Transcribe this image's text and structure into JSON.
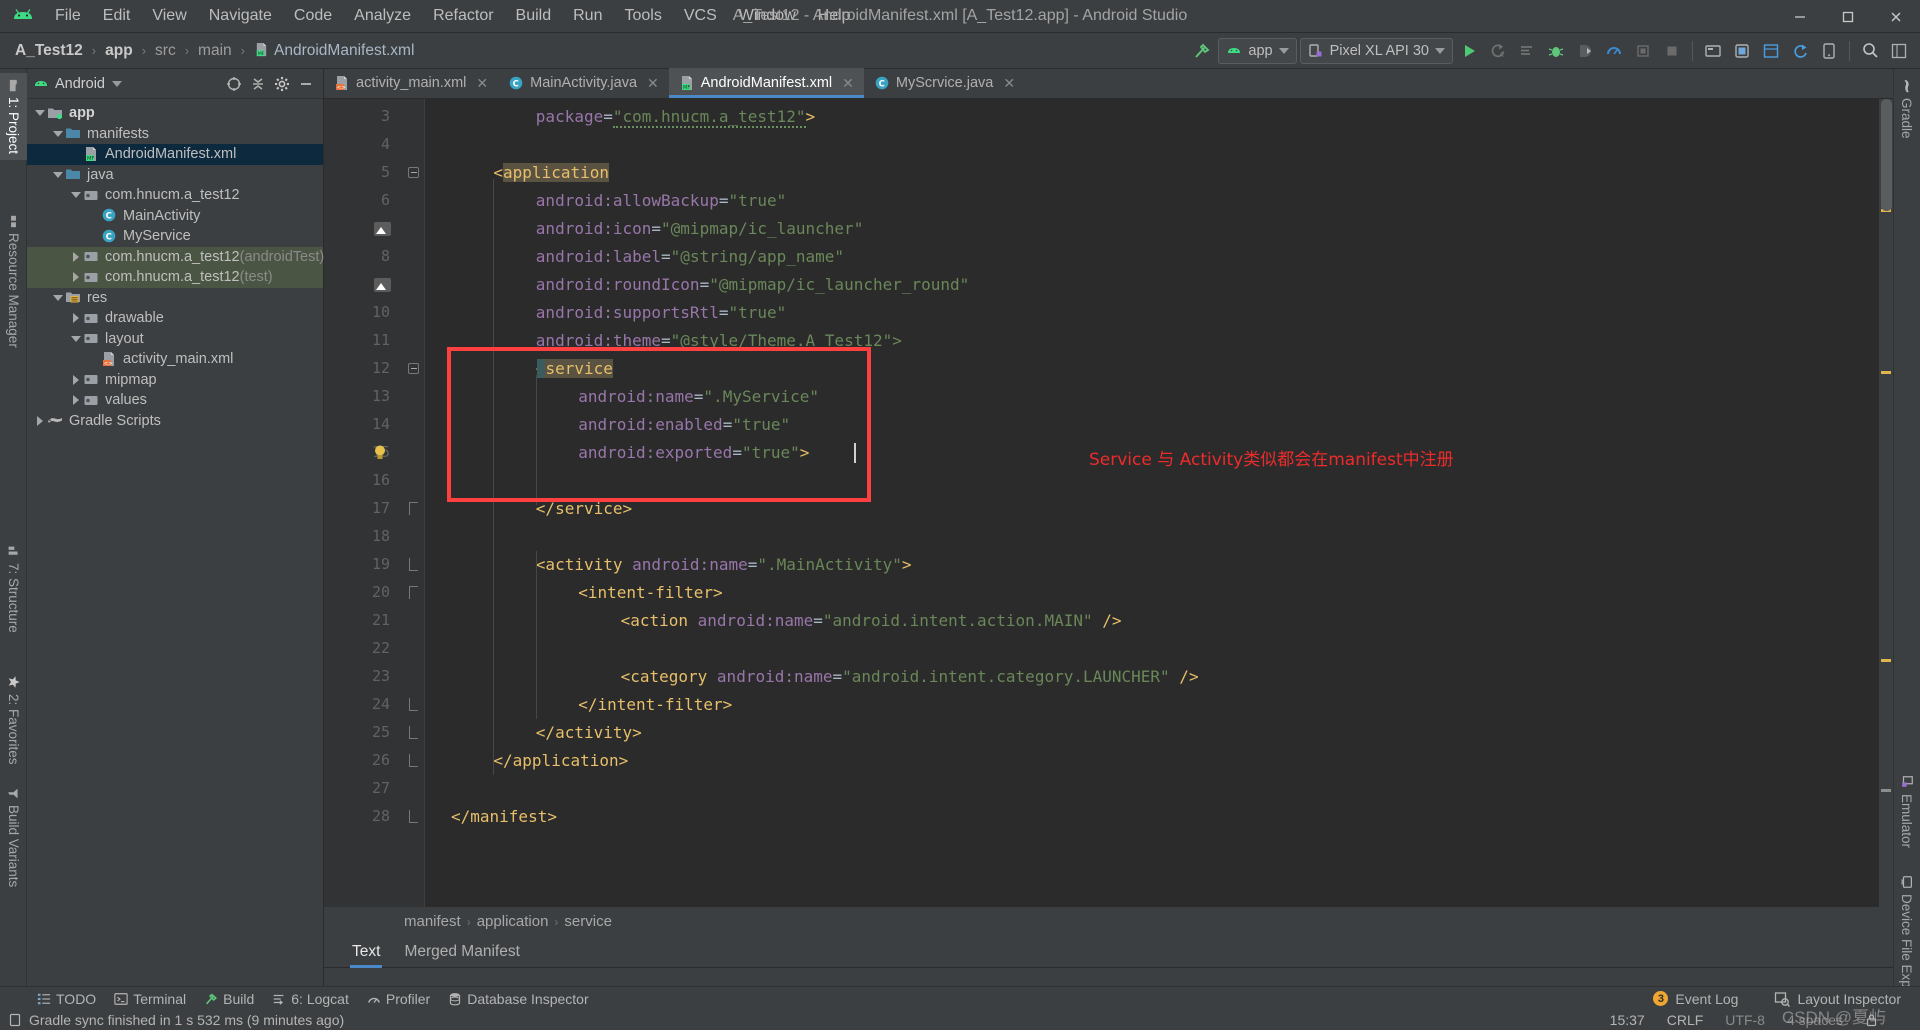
{
  "window": {
    "title": "A_Test12 - AndroidManifest.xml [A_Test12.app] - Android Studio",
    "minimize": "—",
    "maximize": "❐",
    "close": "✕"
  },
  "menubar": {
    "logo_icon": "android-logo-icon",
    "items": [
      {
        "label": "File",
        "mnemonic": "F"
      },
      {
        "label": "Edit",
        "mnemonic": "E"
      },
      {
        "label": "View",
        "mnemonic": "V"
      },
      {
        "label": "Navigate",
        "mnemonic": "N"
      },
      {
        "label": "Code",
        "mnemonic": "C"
      },
      {
        "label": "Analyze",
        "mnemonic": "z"
      },
      {
        "label": "Refactor",
        "mnemonic": "R"
      },
      {
        "label": "Build",
        "mnemonic": "B"
      },
      {
        "label": "Run",
        "mnemonic": "u"
      },
      {
        "label": "Tools",
        "mnemonic": "T"
      },
      {
        "label": "VCS",
        "mnemonic": "S"
      },
      {
        "label": "Window",
        "mnemonic": "W"
      },
      {
        "label": "Help",
        "mnemonic": "H"
      }
    ]
  },
  "navbar": {
    "breadcrumbs": [
      {
        "label": "A_Test12",
        "style": "bold"
      },
      {
        "label": "app",
        "style": "bold"
      },
      {
        "label": "src",
        "style": "dim"
      },
      {
        "label": "main",
        "style": "dim"
      },
      {
        "label": "AndroidManifest.xml",
        "style": "file",
        "icon": "manifest-file-icon"
      }
    ],
    "separator": "›",
    "build_icon": "build-hammer-icon",
    "module_selector": {
      "label": "app",
      "icon": "android-head-icon"
    },
    "device_selector": {
      "label": "Pixel XL API 30",
      "icon": "device-phone-icon"
    },
    "actions": [
      {
        "name": "run-button",
        "icon": "play-icon"
      },
      {
        "name": "apply-changes-button",
        "icon": "apply-changes-icon"
      },
      {
        "name": "apply-code-changes-button",
        "icon": "apply-code-changes-icon"
      },
      {
        "name": "debug-button",
        "icon": "bug-icon"
      },
      {
        "name": "attach-debugger-button",
        "icon": "attach-debugger-icon"
      },
      {
        "name": "profile-button",
        "icon": "profiler-icon"
      },
      {
        "name": "profile-cpu-button",
        "icon": "profile-cpu-icon"
      },
      {
        "name": "stop-button",
        "icon": "stop-icon"
      },
      {
        "name": "sdk-manager-button",
        "icon": "sdk-manager-icon"
      },
      {
        "name": "avd-manager-button",
        "icon": "avd-manager-icon"
      },
      {
        "name": "layout-inspector-button",
        "icon": "layout-inspector-icon"
      },
      {
        "name": "sync-gradle-button",
        "icon": "gradle-sync-icon"
      },
      {
        "name": "device-manager-button",
        "icon": "device-manager-icon"
      },
      {
        "name": "search-everywhere-button",
        "icon": "search-icon"
      },
      {
        "name": "project-structure-button",
        "icon": "project-structure-icon"
      }
    ]
  },
  "left_tool_strip": [
    {
      "label": "1: Project",
      "icon": "project-folder-icon",
      "selected": true
    },
    {
      "label": "Resource Manager",
      "icon": "resource-manager-icon",
      "selected": false
    },
    {
      "label": "7: Structure",
      "icon": "structure-icon",
      "selected": false
    },
    {
      "label": "2: Favorites",
      "icon": "star-icon",
      "selected": false
    },
    {
      "label": "Build Variants",
      "icon": "build-variants-icon",
      "selected": false
    }
  ],
  "right_tool_strip": [
    {
      "label": "Gradle",
      "icon": "gradle-elephant-icon"
    },
    {
      "label": "Emulator",
      "icon": "emulator-icon"
    },
    {
      "label": "Device File Explorer",
      "icon": "device-file-explorer-icon"
    }
  ],
  "project_panel": {
    "title": "Android",
    "dropdown_icon": "chevron-down-icon",
    "actions": [
      {
        "name": "select-opened-file-button",
        "icon": "crosshair-icon"
      },
      {
        "name": "collapse-all-button",
        "icon": "collapse-all-icon"
      },
      {
        "name": "settings-button",
        "icon": "gear-icon"
      },
      {
        "name": "hide-button",
        "icon": "minimize-icon"
      }
    ],
    "tree": [
      {
        "label": "app",
        "indent": 0,
        "arrow": "down",
        "icon": "module-folder-icon",
        "bold": true,
        "state": "normal"
      },
      {
        "label": "manifests",
        "indent": 1,
        "arrow": "down",
        "icon": "folder-icon",
        "bold": false,
        "state": "normal"
      },
      {
        "label": "AndroidManifest.xml",
        "indent": 2,
        "arrow": "none",
        "icon": "manifest-file-icon",
        "bold": false,
        "state": "selected"
      },
      {
        "label": "java",
        "indent": 1,
        "arrow": "down",
        "icon": "folder-icon",
        "bold": false,
        "state": "normal"
      },
      {
        "label": "com.hnucm.a_test12",
        "indent": 2,
        "arrow": "down",
        "icon": "package-icon",
        "bold": false,
        "state": "normal"
      },
      {
        "label": "MainActivity",
        "indent": 3,
        "arrow": "none",
        "icon": "java-class-icon",
        "bold": false,
        "state": "normal"
      },
      {
        "label": "MyService",
        "indent": 3,
        "arrow": "none",
        "icon": "java-class-icon",
        "bold": false,
        "state": "normal"
      },
      {
        "label": "com.hnucm.a_test12",
        "suffix": " (androidTest)",
        "indent": 2,
        "arrow": "right",
        "icon": "package-icon",
        "bold": false,
        "state": "highlight"
      },
      {
        "label": "com.hnucm.a_test12",
        "suffix": " (test)",
        "indent": 2,
        "arrow": "right",
        "icon": "package-icon",
        "bold": false,
        "state": "highlight"
      },
      {
        "label": "res",
        "indent": 1,
        "arrow": "down",
        "icon": "res-folder-icon",
        "bold": false,
        "state": "normal"
      },
      {
        "label": "drawable",
        "indent": 2,
        "arrow": "right",
        "icon": "package-icon",
        "bold": false,
        "state": "normal"
      },
      {
        "label": "layout",
        "indent": 2,
        "arrow": "down",
        "icon": "package-icon",
        "bold": false,
        "state": "normal"
      },
      {
        "label": "activity_main.xml",
        "indent": 3,
        "arrow": "none",
        "icon": "layout-xml-icon",
        "bold": false,
        "state": "normal"
      },
      {
        "label": "mipmap",
        "indent": 2,
        "arrow": "right",
        "icon": "package-icon",
        "bold": false,
        "state": "normal"
      },
      {
        "label": "values",
        "indent": 2,
        "arrow": "right",
        "icon": "package-icon",
        "bold": false,
        "state": "normal"
      },
      {
        "label": "Gradle Scripts",
        "indent": 0,
        "arrow": "right",
        "icon": "gradle-elephant-icon",
        "bold": false,
        "state": "normal"
      }
    ]
  },
  "editor_tabs": [
    {
      "label": "activity_main.xml",
      "icon": "layout-xml-icon",
      "active": false,
      "close": "✕"
    },
    {
      "label": "MainActivity.java",
      "icon": "java-class-icon",
      "active": false,
      "close": "✕"
    },
    {
      "label": "AndroidManifest.xml",
      "icon": "manifest-file-icon",
      "active": true,
      "close": "✕"
    },
    {
      "label": "MyScrvice.java",
      "icon": "java-class-icon",
      "active": false,
      "close": "✕"
    }
  ],
  "editor": {
    "first_line_number": 3,
    "last_line_number": 28,
    "caret_line": 15,
    "lines": [
      {
        "n": 3,
        "indent": 2,
        "tokens": [
          {
            "t": "package",
            "c": "attr"
          },
          {
            "t": "=",
            "c": "plain"
          },
          {
            "t": "\"com.hnucm.a_test12\"",
            "c": "str"
          },
          {
            "t": ">",
            "c": "brk"
          }
        ]
      },
      {
        "n": 4,
        "indent": 0,
        "tokens": []
      },
      {
        "n": 5,
        "indent": 1,
        "tokens": [
          {
            "t": "<",
            "c": "brk"
          },
          {
            "t": "application",
            "c": "hl-tag"
          }
        ]
      },
      {
        "n": 6,
        "indent": 2,
        "tokens": [
          {
            "t": "android:allowBackup",
            "c": "attr"
          },
          {
            "t": "=",
            "c": "plain"
          },
          {
            "t": "\"true\"",
            "c": "str"
          }
        ]
      },
      {
        "n": 7,
        "indent": 2,
        "tokens": [
          {
            "t": "android:icon",
            "c": "attr"
          },
          {
            "t": "=",
            "c": "plain"
          },
          {
            "t": "\"@mipmap/ic_launcher\"",
            "c": "str"
          }
        ]
      },
      {
        "n": 8,
        "indent": 2,
        "tokens": [
          {
            "t": "android:label",
            "c": "attr"
          },
          {
            "t": "=",
            "c": "plain"
          },
          {
            "t": "\"@string/app_name\"",
            "c": "str"
          }
        ]
      },
      {
        "n": 9,
        "indent": 2,
        "tokens": [
          {
            "t": "android:roundIcon",
            "c": "attr"
          },
          {
            "t": "=",
            "c": "plain"
          },
          {
            "t": "\"@mipmap/ic_launcher_round\"",
            "c": "str"
          }
        ]
      },
      {
        "n": 10,
        "indent": 2,
        "tokens": [
          {
            "t": "android:supportsRtl",
            "c": "attr"
          },
          {
            "t": "=",
            "c": "plain"
          },
          {
            "t": "\"true\"",
            "c": "str"
          }
        ]
      },
      {
        "n": 11,
        "indent": 2,
        "tokens": [
          {
            "t": "android:theme",
            "c": "attr"
          },
          {
            "t": "=",
            "c": "plain"
          },
          {
            "t": "\"@style/Theme.A_Test12\">",
            "c": "str"
          }
        ]
      },
      {
        "n": 12,
        "indent": 2,
        "tokens": [
          {
            "t": "<",
            "c": "brk"
          },
          {
            "t": "service",
            "c": "hl-tag"
          }
        ]
      },
      {
        "n": 13,
        "indent": 3,
        "tokens": [
          {
            "t": "android:name",
            "c": "attr"
          },
          {
            "t": "=",
            "c": "plain"
          },
          {
            "t": "\".MyService\"",
            "c": "str"
          }
        ]
      },
      {
        "n": 14,
        "indent": 3,
        "tokens": [
          {
            "t": "android:enabled",
            "c": "attr"
          },
          {
            "t": "=",
            "c": "plain"
          },
          {
            "t": "\"true\"",
            "c": "str"
          }
        ]
      },
      {
        "n": 15,
        "indent": 3,
        "tokens": [
          {
            "t": "android:exported",
            "c": "attr"
          },
          {
            "t": "=",
            "c": "plain"
          },
          {
            "t": "\"true\"",
            "c": "str"
          },
          {
            "t": ">",
            "c": "brk"
          }
        ]
      },
      {
        "n": 16,
        "indent": 0,
        "tokens": []
      },
      {
        "n": 17,
        "indent": 2,
        "tokens": [
          {
            "t": "</service>",
            "c": "tag"
          }
        ]
      },
      {
        "n": 18,
        "indent": 0,
        "tokens": []
      },
      {
        "n": 19,
        "indent": 2,
        "tokens": [
          {
            "t": "<activity ",
            "c": "tag"
          },
          {
            "t": "android:name",
            "c": "attr"
          },
          {
            "t": "=",
            "c": "plain"
          },
          {
            "t": "\".MainActivity\"",
            "c": "str"
          },
          {
            "t": ">",
            "c": "brk"
          }
        ]
      },
      {
        "n": 20,
        "indent": 3,
        "tokens": [
          {
            "t": "<intent-filter>",
            "c": "tag"
          }
        ]
      },
      {
        "n": 21,
        "indent": 4,
        "tokens": [
          {
            "t": "<action ",
            "c": "tag"
          },
          {
            "t": "android:name",
            "c": "attr"
          },
          {
            "t": "=",
            "c": "plain"
          },
          {
            "t": "\"android.intent.action.MAIN\"",
            "c": "str"
          },
          {
            "t": " />",
            "c": "brk"
          }
        ]
      },
      {
        "n": 22,
        "indent": 0,
        "tokens": []
      },
      {
        "n": 23,
        "indent": 4,
        "tokens": [
          {
            "t": "<category ",
            "c": "tag"
          },
          {
            "t": "android:name",
            "c": "attr"
          },
          {
            "t": "=",
            "c": "plain"
          },
          {
            "t": "\"android.intent.category.LAUNCHER\"",
            "c": "str"
          },
          {
            "t": " />",
            "c": "brk"
          }
        ]
      },
      {
        "n": 24,
        "indent": 3,
        "tokens": [
          {
            "t": "</intent-filter>",
            "c": "tag"
          }
        ]
      },
      {
        "n": 25,
        "indent": 2,
        "tokens": [
          {
            "t": "</activity>",
            "c": "tag"
          }
        ]
      },
      {
        "n": 26,
        "indent": 1,
        "tokens": [
          {
            "t": "</application>",
            "c": "tag"
          }
        ]
      },
      {
        "n": 27,
        "indent": 0,
        "tokens": []
      },
      {
        "n": 28,
        "indent": 0,
        "tokens": [
          {
            "t": "</manifest>",
            "c": "tag"
          }
        ]
      }
    ],
    "annotation": {
      "text": "Service 与 Activity类似都会在manifest中注册",
      "color": "#ee2b2b"
    },
    "highlight_box_color": "#ff4040",
    "gutter_image_marker_lines": [
      7,
      9
    ],
    "intention_bulb_line": 15
  },
  "editor_breadcrumbs": {
    "items": [
      "manifest",
      "application",
      "service"
    ],
    "separator": "›"
  },
  "editor_bottom_tabs": [
    {
      "label": "Text",
      "active": true
    },
    {
      "label": "Merged Manifest",
      "active": false
    }
  ],
  "bottom_tool_strip": [
    {
      "label": "TODO",
      "icon": "todo-icon"
    },
    {
      "label": "Terminal",
      "icon": "terminal-icon"
    },
    {
      "label": "Build",
      "icon": "build-hammer-icon"
    },
    {
      "label": "6: Logcat",
      "icon": "logcat-icon",
      "mnemonic": "6"
    },
    {
      "label": "Profiler",
      "icon": "profiler-icon"
    },
    {
      "label": "Database Inspector",
      "icon": "database-icon"
    }
  ],
  "bottom_right": {
    "event_log": {
      "label": "Event Log",
      "count": "3"
    },
    "layout_inspector": {
      "label": "Layout Inspector",
      "icon": "layout-inspector-icon"
    }
  },
  "statusbar": {
    "message": "Gradle sync finished in 1 s 532 ms (9 minutes ago)",
    "message_icon": "notification-icon",
    "caret_position": "15:37",
    "line_separator": "CRLF",
    "encoding": "UTF-8",
    "indent": "4 spaces",
    "lock_icon": "lock-icon",
    "watermark": "CSDN @夏屿"
  },
  "colors": {
    "accent": "#4a88c7",
    "android_green": "#3ddc84",
    "annotation_red": "#ee2b2b",
    "editor_bg": "#2b2b2b",
    "panel_bg": "#3c3f41",
    "string_green": "#6a8759",
    "attr_purple": "#9876aa",
    "tag_yellow": "#e8bf6a"
  }
}
